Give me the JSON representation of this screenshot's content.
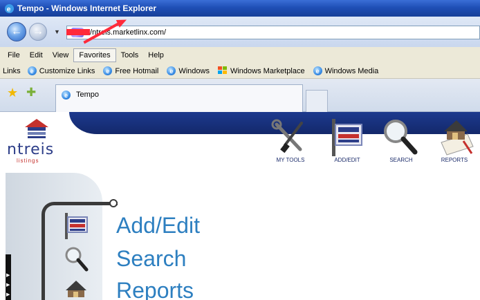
{
  "window": {
    "title": "Tempo - Windows Internet Explorer"
  },
  "address": {
    "url": "//ntreis.marketlinx.com/"
  },
  "menu": [
    "File",
    "Edit",
    "View",
    "Favorites",
    "Tools",
    "Help"
  ],
  "links": {
    "label": "Links",
    "items": [
      "Customize Links",
      "Free Hotmail",
      "Windows",
      "Windows Marketplace",
      "Windows Media"
    ]
  },
  "tab": {
    "title": "Tempo"
  },
  "site": {
    "logo_text": "ntreis",
    "logo_sub": "listings",
    "nav": [
      "MY TOOLS",
      "ADD/EDIT",
      "SEARCH",
      "REPORTS"
    ]
  },
  "content": {
    "items": [
      "Add/Edit",
      "Search",
      "Reports"
    ]
  },
  "colors": {
    "header_blue": "#13286b",
    "link_blue": "#2d7fc0",
    "highlight_red": "#ff2a3a"
  }
}
